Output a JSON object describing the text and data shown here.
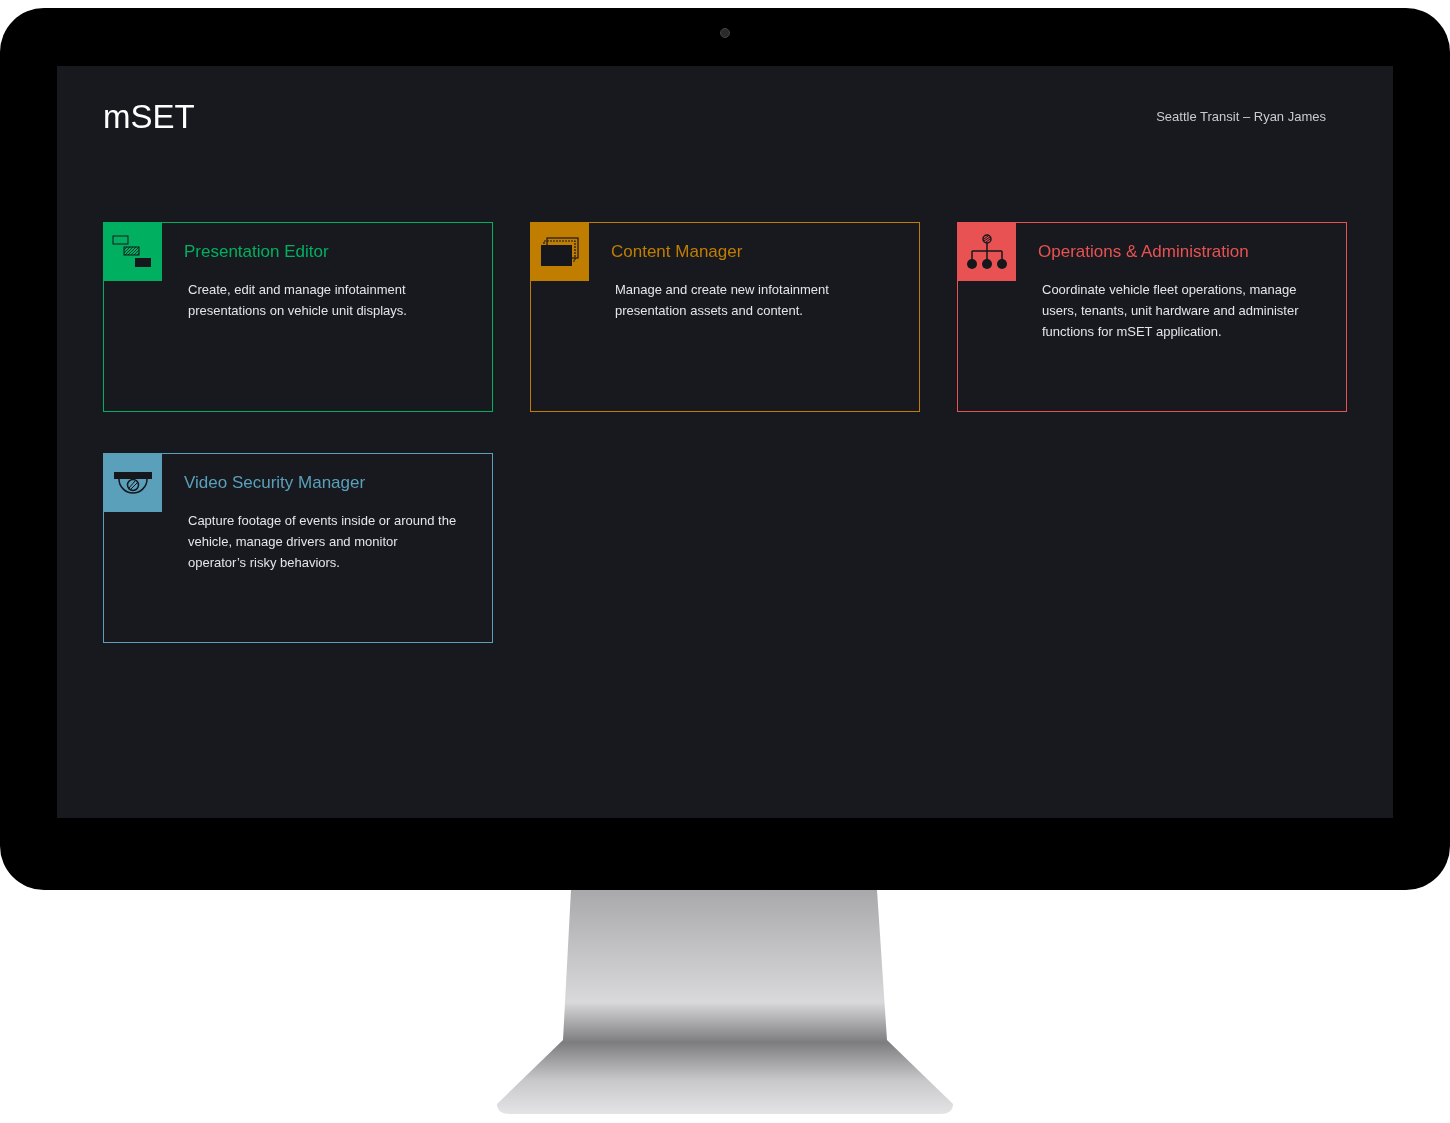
{
  "header": {
    "logo": "mSET",
    "account": "Seattle Transit – Ryan James"
  },
  "apps": [
    {
      "kind": "editor",
      "color": "#00b060",
      "title": "Presentation Editor",
      "description": "Create, edit and manage infotainment presentations on vehicle unit displays."
    },
    {
      "kind": "content",
      "color": "#c17d00",
      "title": "Content Manager",
      "description": "Manage and create new infotainment presentation assets and content."
    },
    {
      "kind": "operations",
      "color": "#e85252",
      "title": "Operations & Administration",
      "description": "Coordinate vehicle fleet operations, manage users, tenants, unit hardware and administer functions for mSET application."
    },
    {
      "kind": "video",
      "color": "#5aa0bb",
      "title": "Video Security Manager",
      "description": "Capture footage of events inside or around the vehicle, manage drivers and monitor operator’s risky behaviors."
    }
  ]
}
